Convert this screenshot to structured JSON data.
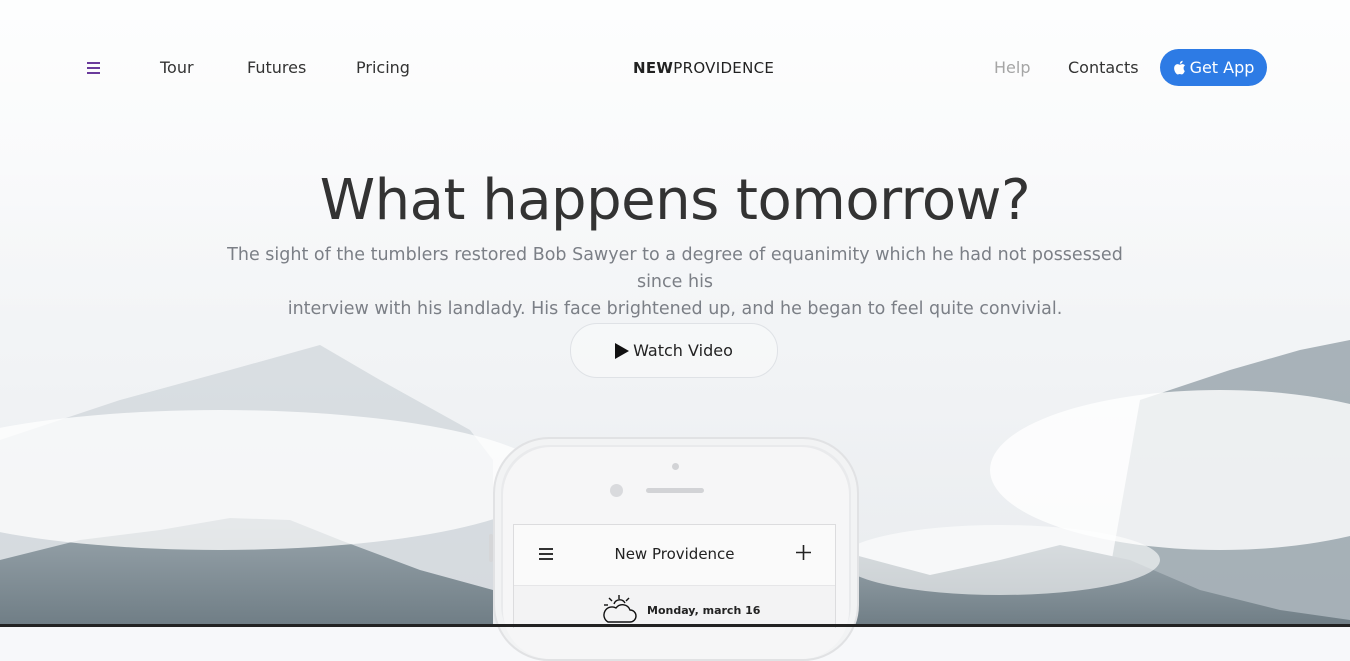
{
  "nav": {
    "menu_icon": "hamburger-menu-icon",
    "links": [
      "Tour",
      "Futures",
      "Pricing"
    ],
    "brand_bold": "NEW",
    "brand_light": "PROVIDENCE",
    "right_links": [
      "Help",
      "Contacts"
    ],
    "get_app_label": "Get App",
    "get_app_icon": "apple-icon",
    "colors": {
      "accent": "#2d7be5",
      "menu_icon": "#6a3b9c",
      "muted": "#a5a5a5"
    }
  },
  "hero": {
    "title": "What happens tomorrow?",
    "text_line1": "The sight of the tumblers restored Bob Sawyer to a degree of equanimity which he had not possessed since his",
    "text_line2": "interview with his landlady. His face brightened up, and he began to feel quite convivial.",
    "watch_label": "Watch Video",
    "watch_icon": "play-icon"
  },
  "phone_app": {
    "menu_icon": "hamburger-menu-icon",
    "title": "New Providence",
    "add_icon": "plus-icon",
    "weather_icon": "sun-cloud-icon",
    "date": "Monday, march 16"
  }
}
